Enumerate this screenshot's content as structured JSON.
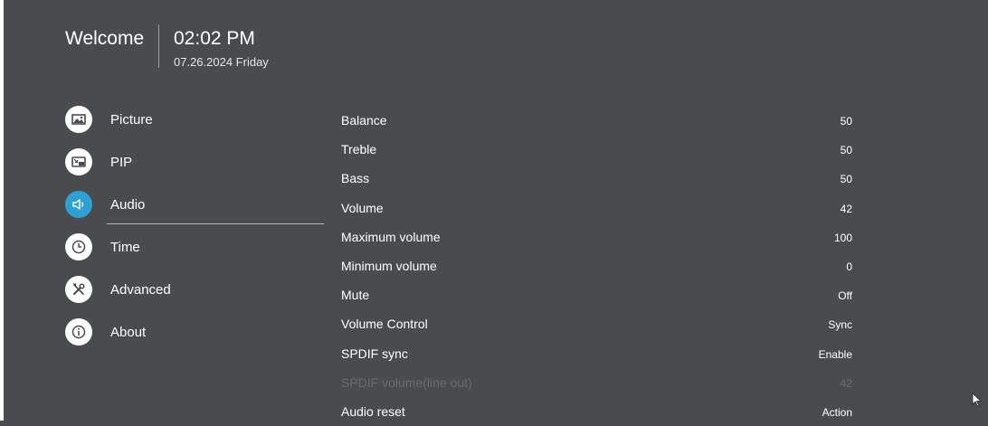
{
  "header": {
    "welcome": "Welcome",
    "time": "02:02 PM",
    "date": "07.26.2024 Friday"
  },
  "nav": {
    "items": [
      {
        "label": "Picture",
        "icon": "picture-icon"
      },
      {
        "label": "PIP",
        "icon": "pip-icon"
      },
      {
        "label": "Audio",
        "icon": "speaker-icon",
        "active": true
      },
      {
        "label": "Time",
        "icon": "clock-icon"
      },
      {
        "label": "Advanced",
        "icon": "tools-icon"
      },
      {
        "label": "About",
        "icon": "info-icon"
      }
    ]
  },
  "audio": {
    "rows": [
      {
        "label": "Balance",
        "value": "50"
      },
      {
        "label": "Treble",
        "value": "50"
      },
      {
        "label": "Bass",
        "value": "50"
      },
      {
        "label": "Volume",
        "value": "42"
      },
      {
        "label": "Maximum volume",
        "value": "100"
      },
      {
        "label": "Minimum volume",
        "value": "0"
      },
      {
        "label": "Mute",
        "value": "Off"
      },
      {
        "label": "Volume Control",
        "value": "Sync"
      },
      {
        "label": "SPDIF sync",
        "value": "Enable"
      },
      {
        "label": "SPDIF volume(line out)",
        "value": "42",
        "disabled": true
      },
      {
        "label": "Audio reset",
        "value": "Action"
      }
    ]
  },
  "colors": {
    "background": "#4a4b4f",
    "accent": "#2fa0d2",
    "disabled_text": "#6a6b6f"
  }
}
